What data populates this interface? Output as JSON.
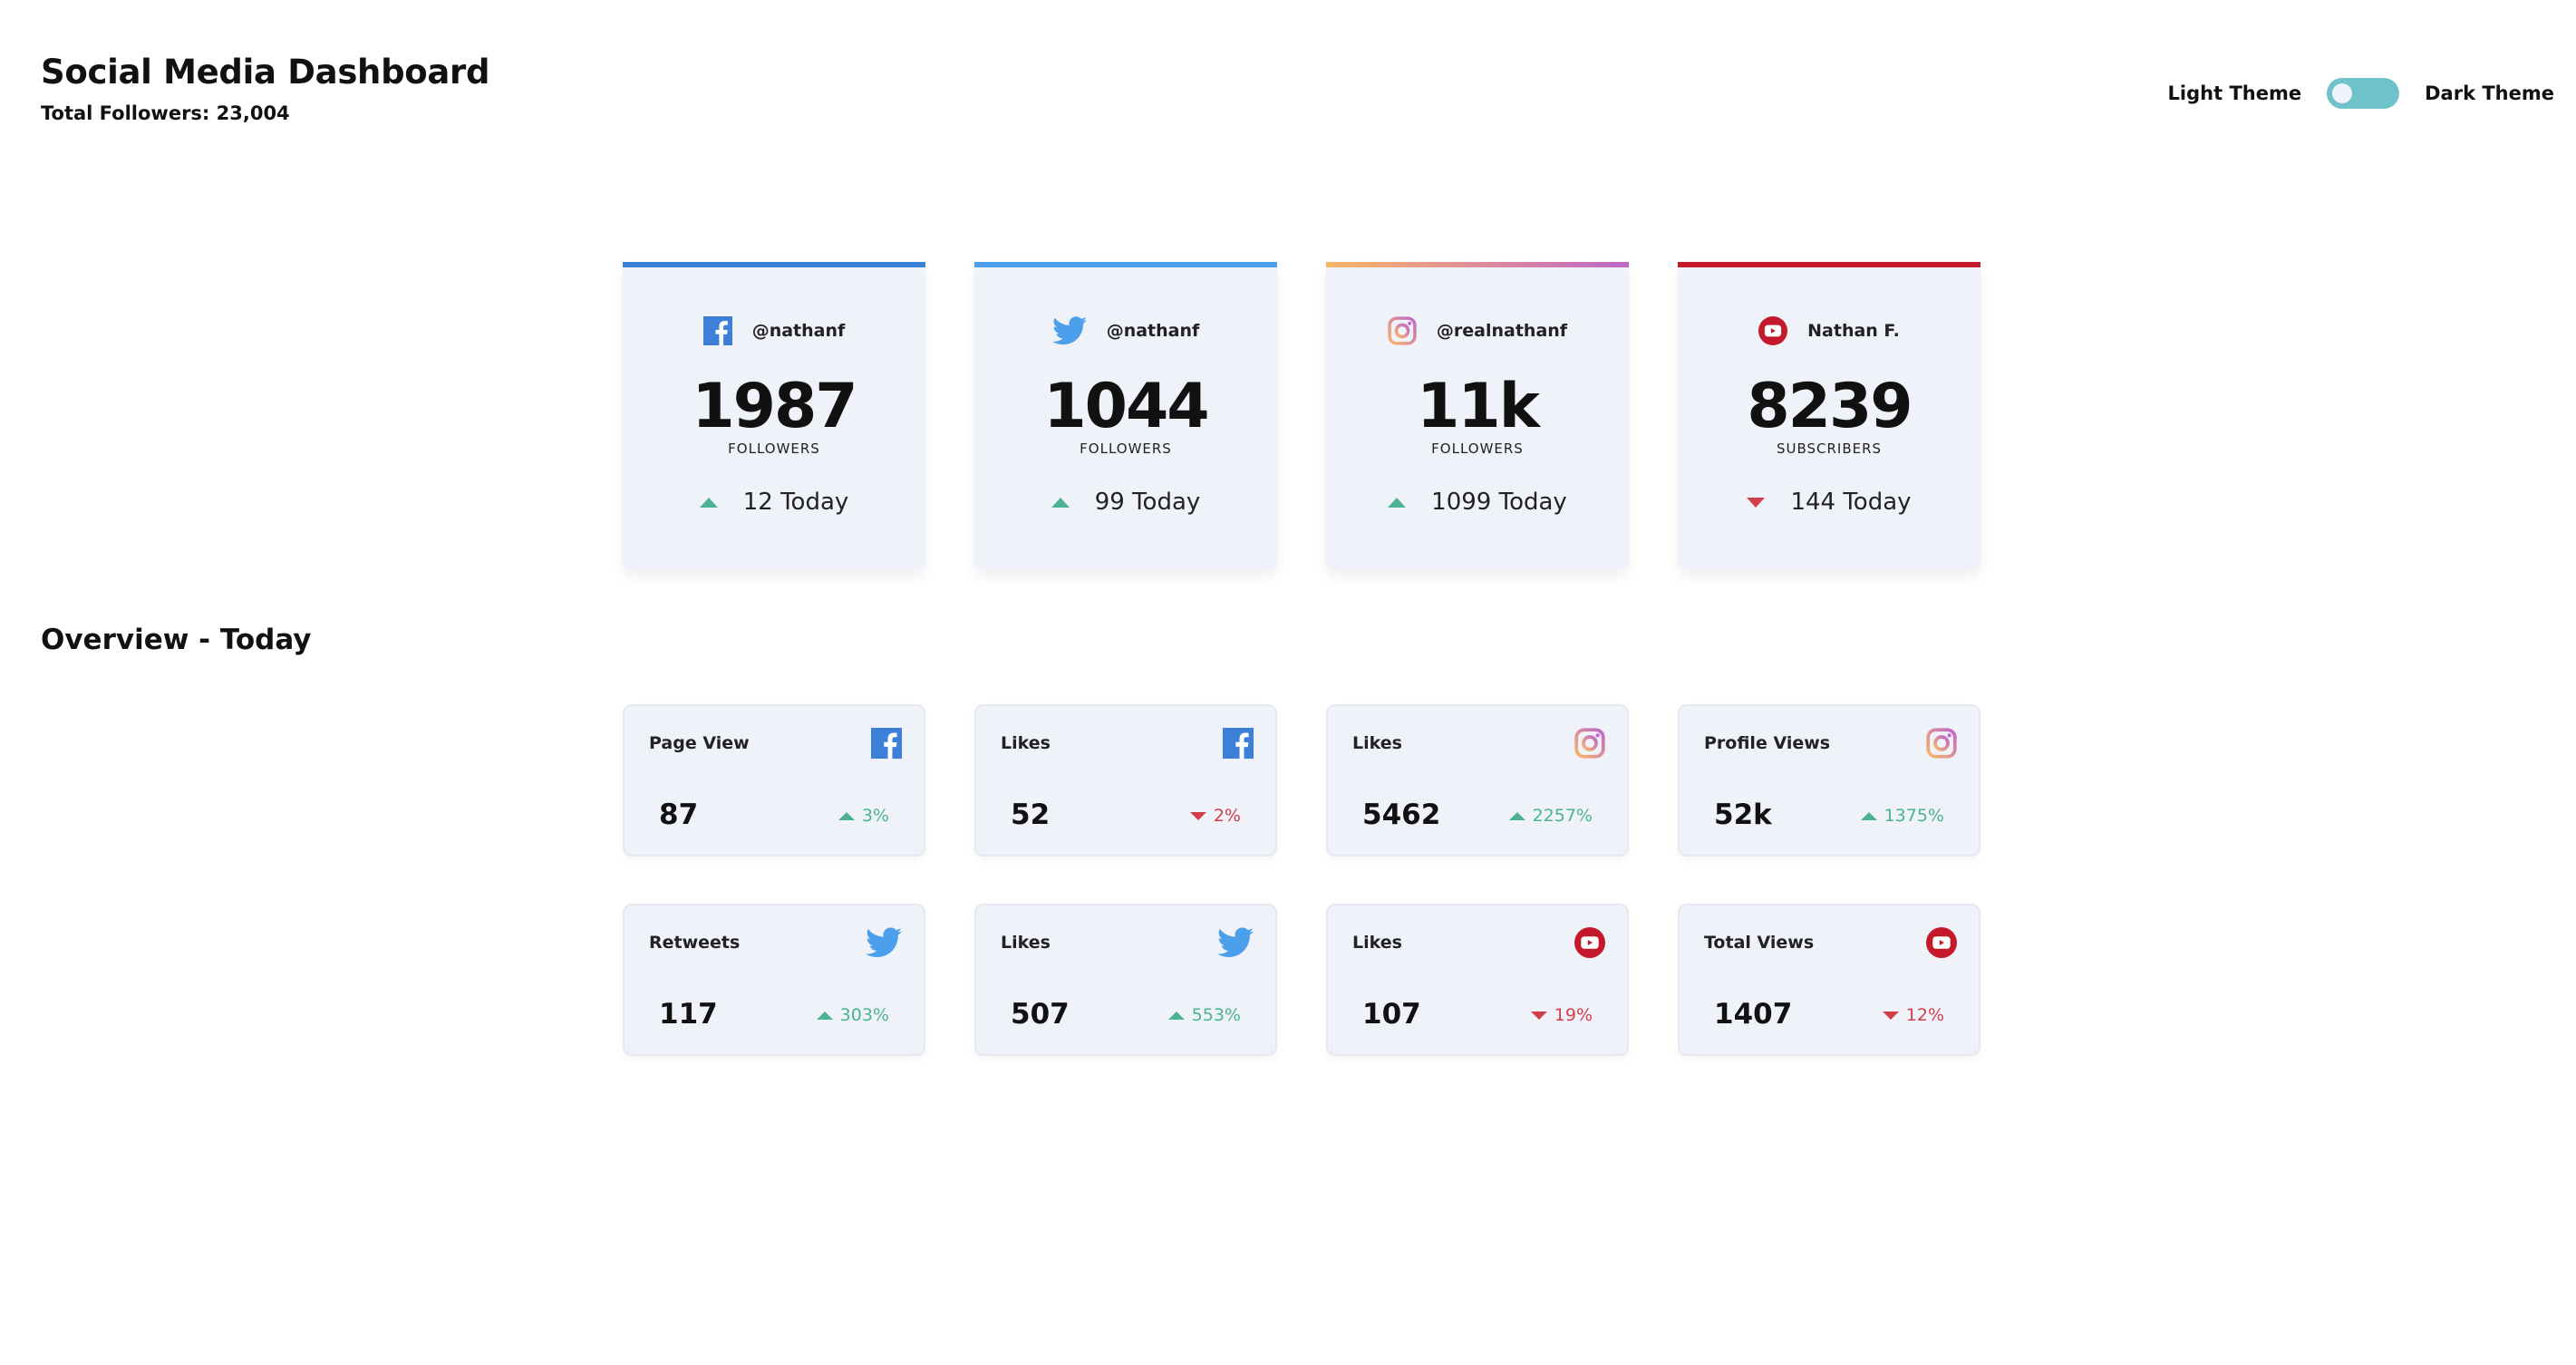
{
  "header": {
    "title": "Social Media Dashboard",
    "total_followers": "Total Followers: 23,004"
  },
  "theme": {
    "light_label": "Light Theme",
    "dark_label": "Dark Theme",
    "toggle_color": "#6fc2c9"
  },
  "colors": {
    "facebook": "#3c80d9",
    "twitter": "#4c9feb",
    "instagram_gradient": [
      "#f8b668",
      "#c066c9"
    ],
    "youtube": "#c4182b",
    "up": "#4bb393",
    "down": "#d13f4b"
  },
  "followers": [
    {
      "platform_icon": "facebook-icon",
      "handle": "@nathanf",
      "count": "1987",
      "unit": "FOLLOWERS",
      "today": "12 Today",
      "trend": "up"
    },
    {
      "platform_icon": "twitter-icon",
      "handle": "@nathanf",
      "count": "1044",
      "unit": "FOLLOWERS",
      "today": "99 Today",
      "trend": "up"
    },
    {
      "platform_icon": "instagram-icon",
      "handle": "@realnathanf",
      "count": "11k",
      "unit": "FOLLOWERS",
      "today": "1099 Today",
      "trend": "up"
    },
    {
      "platform_icon": "youtube-icon",
      "handle": "Nathan F.",
      "count": "8239",
      "unit": "SUBSCRIBERS",
      "today": "144 Today",
      "trend": "down"
    }
  ],
  "overview": {
    "title": "Overview - Today",
    "cards": [
      {
        "label": "Page View",
        "icon": "facebook-icon",
        "value": "87",
        "pct": "3%",
        "trend": "up"
      },
      {
        "label": "Likes",
        "icon": "facebook-icon",
        "value": "52",
        "pct": "2%",
        "trend": "down"
      },
      {
        "label": "Likes",
        "icon": "instagram-icon",
        "value": "5462",
        "pct": "2257%",
        "trend": "up"
      },
      {
        "label": "Profile Views",
        "icon": "instagram-icon",
        "value": "52k",
        "pct": "1375%",
        "trend": "up"
      },
      {
        "label": "Retweets",
        "icon": "twitter-icon",
        "value": "117",
        "pct": "303%",
        "trend": "up"
      },
      {
        "label": "Likes",
        "icon": "twitter-icon",
        "value": "507",
        "pct": "553%",
        "trend": "up"
      },
      {
        "label": "Likes",
        "icon": "youtube-icon",
        "value": "107",
        "pct": "19%",
        "trend": "down"
      },
      {
        "label": "Total Views",
        "icon": "youtube-icon",
        "value": "1407",
        "pct": "12%",
        "trend": "down"
      }
    ]
  }
}
